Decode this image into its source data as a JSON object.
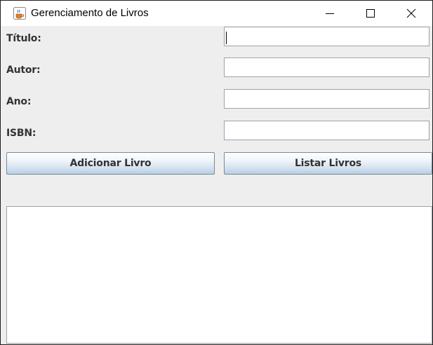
{
  "window": {
    "title": "Gerenciamento de Livros",
    "icon": "java-cup-icon"
  },
  "titlebar_buttons": {
    "minimize": "minimize-icon",
    "maximize": "maximize-icon",
    "close": "close-icon"
  },
  "form": {
    "titulo_label": "Título:",
    "autor_label": "Autor:",
    "ano_label": "Ano:",
    "isbn_label": "ISBN:",
    "titulo_value": "",
    "autor_value": "",
    "ano_value": "",
    "isbn_value": ""
  },
  "buttons": {
    "add_label": "Adicionar Livro",
    "list_label": "Listar Livros"
  },
  "output": {
    "text": ""
  },
  "colors": {
    "window_bg": "#eeeeee",
    "titlebar_bg": "#ffffff",
    "button_gradient_top": "#ffffff",
    "button_gradient_bottom": "#b8cfe5"
  }
}
